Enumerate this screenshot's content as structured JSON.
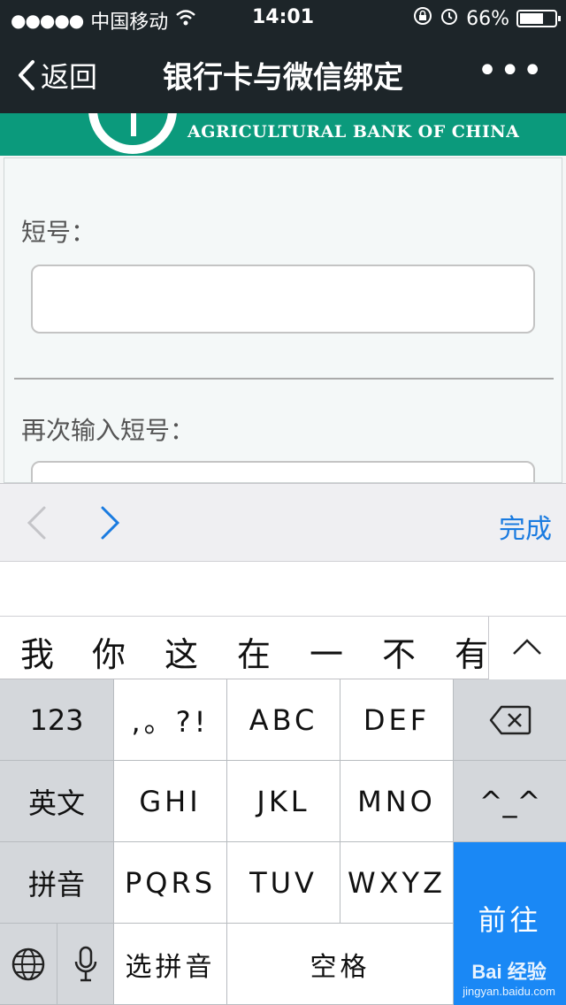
{
  "status_bar": {
    "carrier": "中国移动",
    "time": "14:01",
    "battery": "66%"
  },
  "nav": {
    "back_label": "返回",
    "title": "银行卡与微信绑定",
    "more_label": "•••"
  },
  "banner": {
    "bank_name": "AGRICULTURAL BANK OF CHINA"
  },
  "form": {
    "field1_label": "短号：",
    "field1_value": "",
    "field2_label": "再次输入短号：",
    "field2_value": ""
  },
  "accessory": {
    "done_label": "完成"
  },
  "candidates": [
    "我",
    "你",
    "这",
    "在",
    "一",
    "不",
    "有"
  ],
  "keyboard": {
    "row1": [
      "123",
      ",。?!",
      "ABC",
      "DEF"
    ],
    "row2": [
      "英文",
      "GHI",
      "JKL",
      "MNO",
      "^_^"
    ],
    "row3": [
      "拼音",
      "PQRS",
      "TUV",
      "WXYZ"
    ],
    "row4": [
      "选拼音",
      "空格"
    ],
    "go_label": "前往"
  },
  "watermark": {
    "main": "Bai 经验",
    "sub": "jingyan.baidu.com"
  },
  "colors": {
    "nav_bg": "#1d2529",
    "banner_bg": "#0b9a7c",
    "accent": "#1a88f5",
    "done": "#1a7be0"
  }
}
